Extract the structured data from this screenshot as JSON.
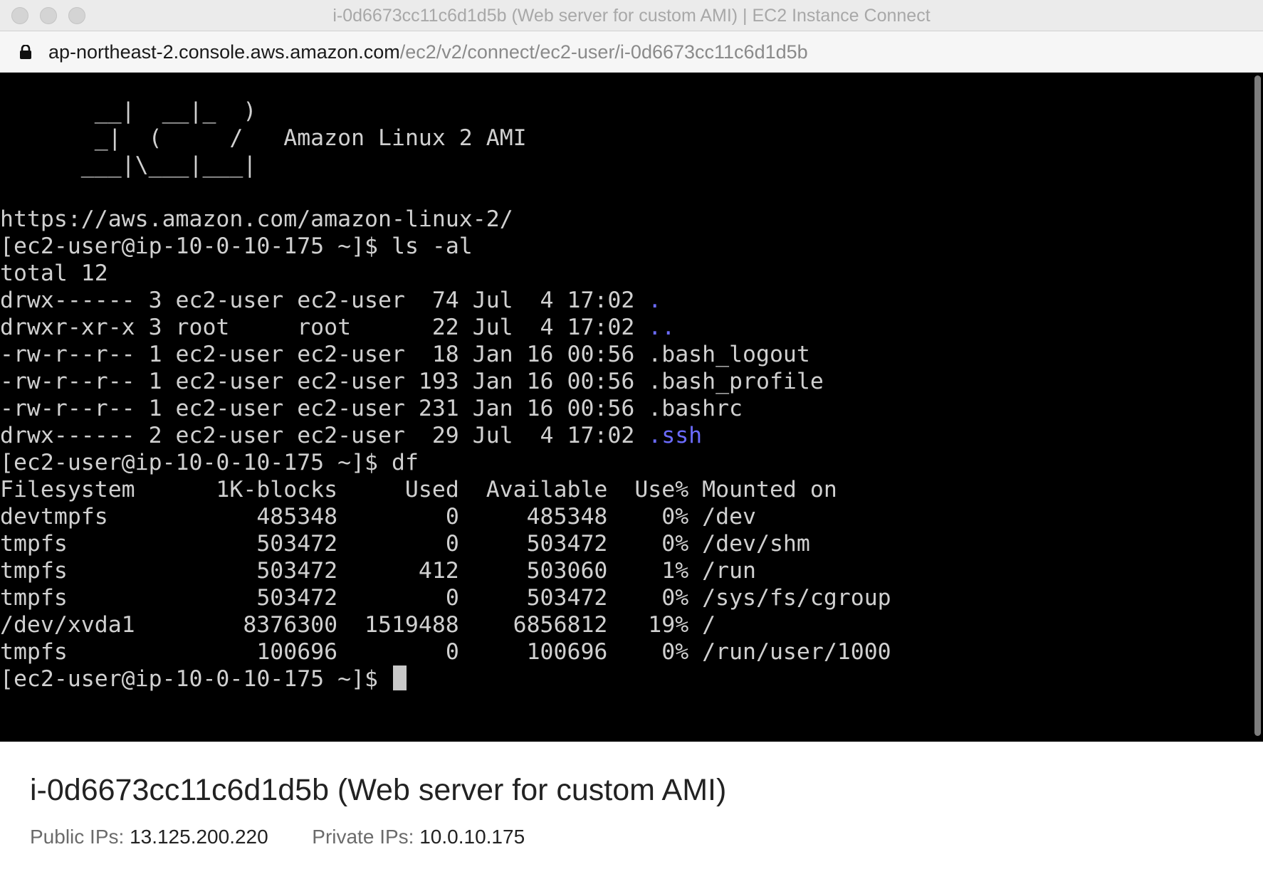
{
  "window": {
    "title": "i-0d6673cc11c6d1d5b (Web server for custom AMI) | EC2 Instance Connect"
  },
  "address_bar": {
    "host": "ap-northeast-2.console.aws.amazon.com",
    "path": "/ec2/v2/connect/ec2-user/i-0d6673cc11c6d1d5b",
    "icon": "lock-icon"
  },
  "terminal": {
    "banner": [
      "       __|  __|_  )",
      "       _|  (     /   Amazon Linux 2 AMI",
      "      ___|\\___|___|"
    ],
    "url_line": "https://aws.amazon.com/amazon-linux-2/",
    "prompt": "[ec2-user@ip-10-0-10-175 ~]$",
    "commands": {
      "ls": "ls -al",
      "df": "df"
    },
    "ls_total": "total 12",
    "ls_rows": [
      {
        "perms": "drwx------",
        "links": "3",
        "owner": "ec2-user",
        "group": "ec2-user",
        "size": "74",
        "month": "Jul",
        "day": "4",
        "time": "17:02",
        "name": ".",
        "is_dir": true
      },
      {
        "perms": "drwxr-xr-x",
        "links": "3",
        "owner": "root",
        "group": "root",
        "size": "22",
        "month": "Jul",
        "day": "4",
        "time": "17:02",
        "name": "..",
        "is_dir": true
      },
      {
        "perms": "-rw-r--r--",
        "links": "1",
        "owner": "ec2-user",
        "group": "ec2-user",
        "size": "18",
        "month": "Jan",
        "day": "16",
        "time": "00:56",
        "name": ".bash_logout",
        "is_dir": false
      },
      {
        "perms": "-rw-r--r--",
        "links": "1",
        "owner": "ec2-user",
        "group": "ec2-user",
        "size": "193",
        "month": "Jan",
        "day": "16",
        "time": "00:56",
        "name": ".bash_profile",
        "is_dir": false
      },
      {
        "perms": "-rw-r--r--",
        "links": "1",
        "owner": "ec2-user",
        "group": "ec2-user",
        "size": "231",
        "month": "Jan",
        "day": "16",
        "time": "00:56",
        "name": ".bashrc",
        "is_dir": false
      },
      {
        "perms": "drwx------",
        "links": "2",
        "owner": "ec2-user",
        "group": "ec2-user",
        "size": "29",
        "month": "Jul",
        "day": "4",
        "time": "17:02",
        "name": ".ssh",
        "is_dir": true
      }
    ],
    "df_headers": [
      "Filesystem",
      "1K-blocks",
      "Used",
      "Available",
      "Use%",
      "Mounted on"
    ],
    "df_rows": [
      [
        "devtmpfs",
        "485348",
        "0",
        "485348",
        "0%",
        "/dev"
      ],
      [
        "tmpfs",
        "503472",
        "0",
        "503472",
        "0%",
        "/dev/shm"
      ],
      [
        "tmpfs",
        "503472",
        "412",
        "503060",
        "1%",
        "/run"
      ],
      [
        "tmpfs",
        "503472",
        "0",
        "503472",
        "0%",
        "/sys/fs/cgroup"
      ],
      [
        "/dev/xvda1",
        "8376300",
        "1519488",
        "6856812",
        "19%",
        "/"
      ],
      [
        "tmpfs",
        "100696",
        "0",
        "100696",
        "0%",
        "/run/user/1000"
      ]
    ],
    "colors": {
      "background": "#000000",
      "text": "#d0d0d0",
      "directory": "#6b6bff"
    }
  },
  "instance": {
    "title": "i-0d6673cc11c6d1d5b (Web server for custom AMI)",
    "public_ips_label": "Public IPs:",
    "public_ips": "13.125.200.220",
    "private_ips_label": "Private IPs:",
    "private_ips": "10.0.10.175"
  }
}
